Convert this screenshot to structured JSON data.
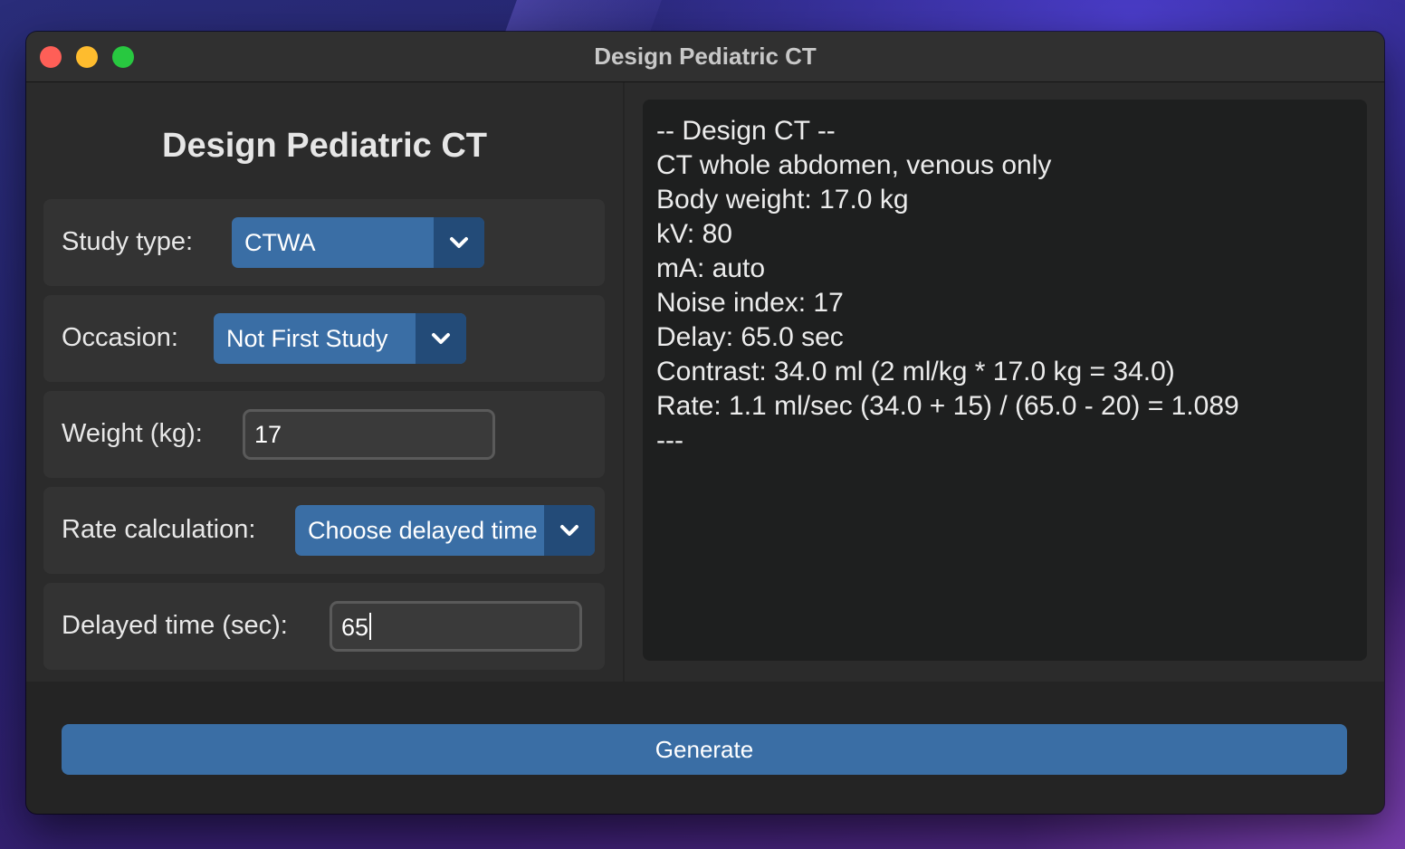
{
  "window": {
    "title": "Design Pediatric CT"
  },
  "form": {
    "heading": "Design Pediatric CT",
    "study_type": {
      "label": "Study type:",
      "value": "CTWA"
    },
    "occasion": {
      "label": "Occasion:",
      "value": "Not First Study"
    },
    "weight": {
      "label": "Weight (kg):",
      "value": "17"
    },
    "rate_calculation": {
      "label": "Rate calculation:",
      "value": "Choose delayed time"
    },
    "delayed_time": {
      "label": "Delayed time (sec):",
      "value": "65"
    }
  },
  "output": {
    "lines": [
      "-- Design CT --",
      "CT whole abdomen, venous only",
      "Body weight: 17.0 kg",
      "kV: 80",
      "mA: auto",
      "Noise index: 17",
      "Delay: 65.0 sec",
      "Contrast: 34.0 ml (2 ml/kg * 17.0 kg = 34.0)",
      "Rate: 1.1 ml/sec (34.0 + 15) / (65.0 - 20) = 1.089",
      "---"
    ]
  },
  "actions": {
    "generate_label": "Generate"
  },
  "icons": {
    "dropdown_arrow": "chevron-down-icon"
  },
  "colors": {
    "accent": "#3a6ea5",
    "accent_dark": "#234b78",
    "close": "#fe5f57",
    "minimize": "#febc2e",
    "maximize": "#28c840"
  }
}
